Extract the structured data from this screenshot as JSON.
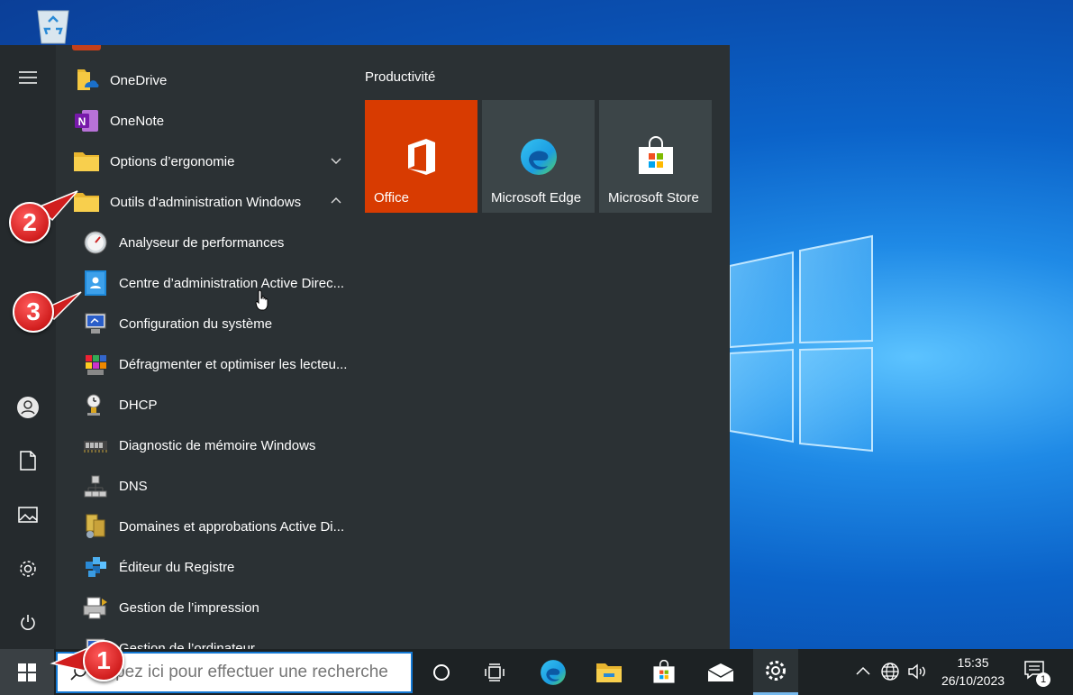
{
  "start_menu": {
    "apps": [
      {
        "label": "OneDrive",
        "icon": "onedrive-icon"
      },
      {
        "label": "OneNote",
        "icon": "onenote-icon"
      },
      {
        "label": "Options d’ergonomie",
        "icon": "folder-icon"
      },
      {
        "label": "Outils d'administration Windows",
        "icon": "folder-icon"
      },
      {
        "label": "Analyseur de performances",
        "icon": "perfmon-icon"
      },
      {
        "label": "Centre d’administration Active Direc...",
        "icon": "ad-admin-center-icon"
      },
      {
        "label": "Configuration du système",
        "icon": "msconfig-icon"
      },
      {
        "label": "Défragmenter et optimiser les lecteu...",
        "icon": "defrag-icon"
      },
      {
        "label": "DHCP",
        "icon": "dhcp-icon"
      },
      {
        "label": "Diagnostic de mémoire Windows",
        "icon": "memory-diagnostic-icon"
      },
      {
        "label": "DNS",
        "icon": "dns-icon"
      },
      {
        "label": "Domaines et approbations Active Di...",
        "icon": "domains-trusts-icon"
      },
      {
        "label": "Éditeur du Registre",
        "icon": "regedit-icon"
      },
      {
        "label": "Gestion de l’impression",
        "icon": "print-management-icon"
      },
      {
        "label": "Gestion de l’ordinateur",
        "icon": "computer-management-icon"
      }
    ],
    "tiles_group": "Productivité",
    "tiles": [
      {
        "label": "Office",
        "color": "#d83b01"
      },
      {
        "label": "Microsoft Edge",
        "color": "#3c4548"
      },
      {
        "label": "Microsoft Store",
        "color": "#3c4548"
      }
    ]
  },
  "taskbar": {
    "search_placeholder": "Tapez ici pour effectuer une recherche",
    "time": "15:35",
    "date": "26/10/2023",
    "notification_count": "1"
  },
  "callouts": [
    "1",
    "2",
    "3"
  ]
}
